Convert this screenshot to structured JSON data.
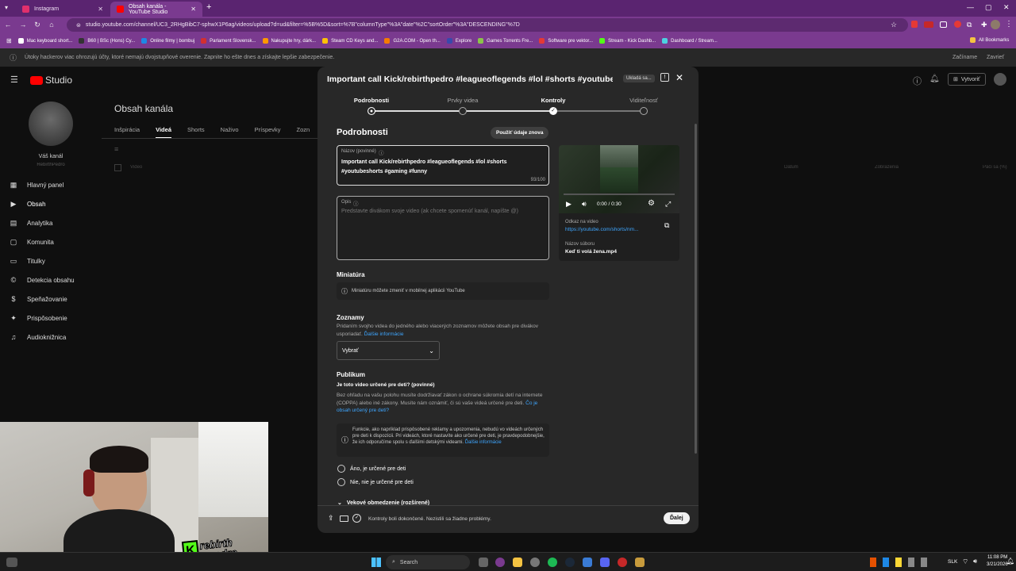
{
  "browser": {
    "tabs": [
      {
        "title": "Instagram",
        "color": "#e1306c"
      },
      {
        "title": "Obsah kanála - YouTube Studio",
        "color": "#ff0000"
      }
    ],
    "url": "studio.youtube.com/channel/UC3_2RHgBibC7-sphwX1P6ag/videos/upload?d=ud&filter=%5B%5D&sort=%7B\"columnType\"%3A\"date\"%2C\"sortOrder\"%3A\"DESCENDING\"%7D",
    "bookmarks": [
      {
        "label": "Mac keyboard short...",
        "color": "#ffffff"
      },
      {
        "label": "B60 | BSc (Hons) Cy...",
        "color": "#333333"
      },
      {
        "label": "Online filmy | bombuj",
        "color": "#1e88e5"
      },
      {
        "label": "Parlament Slovensk...",
        "color": "#d32f2f"
      },
      {
        "label": "Nakupujte hry, dárk...",
        "color": "#ff9800"
      },
      {
        "label": "Steam CD Keys and...",
        "color": "#ffc107"
      },
      {
        "label": "G2A.COM - Open th...",
        "color": "#f57c00"
      },
      {
        "label": "Explore",
        "color": "#3949ab"
      },
      {
        "label": "Games Torrents Fre...",
        "color": "#8bc34a"
      },
      {
        "label": "Software pre vektor...",
        "color": "#e53935"
      },
      {
        "label": "Stream - Kick Dashb...",
        "color": "#53fc18"
      },
      {
        "label": "Dashboard / Stream...",
        "color": "#4dd0e1"
      }
    ],
    "all_bookmarks": "All Bookmarks"
  },
  "banner": {
    "text": "Útoky hackerov viac ohrozujú účty, ktoré nemajú dvojstupňové overenie. Zapnite ho ešte dnes a získajte lepšie zabezpečenie.",
    "start": "Začíname",
    "close": "Zavrieť"
  },
  "studio": {
    "logo": "Studio",
    "channel_label": "Váš kanál",
    "channel_name": "RebirthPedro",
    "create": "Vytvoriť",
    "page_title": "Obsah kanála",
    "tabs": [
      "Inšpirácia",
      "Videá",
      "Shorts",
      "Naživo",
      "Príspevky",
      "Zozn"
    ],
    "nav": [
      {
        "label": "Hlavný panel",
        "icon": "▦"
      },
      {
        "label": "Obsah",
        "icon": "▶"
      },
      {
        "label": "Analytika",
        "icon": "▤"
      },
      {
        "label": "Komunita",
        "icon": "▢"
      },
      {
        "label": "Titulky",
        "icon": "▭"
      },
      {
        "label": "Detekcia obsahu",
        "icon": "©"
      },
      {
        "label": "Speňažovanie",
        "icon": "$"
      },
      {
        "label": "Prispôsobenie",
        "icon": "✦"
      },
      {
        "label": "Audioknižnica",
        "icon": "♫"
      }
    ],
    "columns": [
      "Video",
      "Dátum",
      "Zobrazenia",
      "Páči sa (%)"
    ]
  },
  "modal": {
    "title": "Important call Kick/rebirthpedro #leagueoflegends #lol #shorts #youtube...",
    "saving": "Ukladá sa...",
    "steps": [
      {
        "label": "Podrobnosti",
        "state": "current"
      },
      {
        "label": "Prvky videa",
        "state": "pending"
      },
      {
        "label": "Kontroly",
        "state": "done"
      },
      {
        "label": "Viditeľnosť",
        "state": "pending"
      }
    ],
    "heading": "Podrobnosti",
    "reuse": "Použiť údaje znova",
    "title_field": {
      "label": "Názov (povinné)",
      "value": "Important call Kick/rebirthpedro #leagueoflegends #lol #shorts #youtubeshorts #gaming #funny",
      "counter": "93/100"
    },
    "desc_field": {
      "label": "Opis",
      "placeholder": "Predstavte divákom svoje video (ak chcete spomenúť kanál, napíšte @)"
    },
    "player": {
      "time": "0:00 / 0:30",
      "link_label": "Odkaz na video",
      "link": "https://youtube.com/shorts/nm...",
      "file_label": "Názov súboru",
      "file": "Keď ti volá žena.mp4"
    },
    "thumbnail": {
      "heading": "Miniatúra",
      "info": "Miniatúru môžete zmeniť v mobilnej aplikácii YouTube"
    },
    "playlists": {
      "heading": "Zoznamy",
      "text": "Pridaním svojho videa do jedného alebo viacerých zoznamov môžete obsah pre divákov usporiadať.",
      "more": "Ďalšie informácie",
      "select": "Vybrať"
    },
    "audience": {
      "heading": "Publikum",
      "question": "Je toto video určené pre deti? (povinné)",
      "text": "Bez ohľadu na vašu polohu musíte dodržiavať zákon o ochrane súkromia detí na internete (COPPA) alebo iné zákony. Musíte nám oznámiť, či sú vaše videá určené pre deti.",
      "text_link": "Čo je obsah určený pre deti?",
      "info": "Funkcie, ako napríklad prispôsobené reklamy a upozornenia, nebudú vo videách určených pre deti k dispozícii. Pri videách, ktoré nastavíte ako určené pre deti, je pravdepodobnejšie, že ich odporučíme spolu s ďalšími detskými videami.",
      "info_link": "Ďalšie informácie",
      "yes": "Áno, je určené pre deti",
      "no": "Nie, nie je určené pre deti",
      "age": "Vekové obmedzenie (rozšírené)"
    },
    "footer": {
      "status": "Kontroly boli dokončené. Nezistili sa žiadne problémy.",
      "next": "Ďalej"
    }
  },
  "overlay": {
    "brand_top": "rebirth",
    "brand_bottom": "pedro"
  },
  "taskbar": {
    "search": "Search",
    "lang": "SLK",
    "time": "11:08 PM",
    "date": "3/21/2026"
  }
}
